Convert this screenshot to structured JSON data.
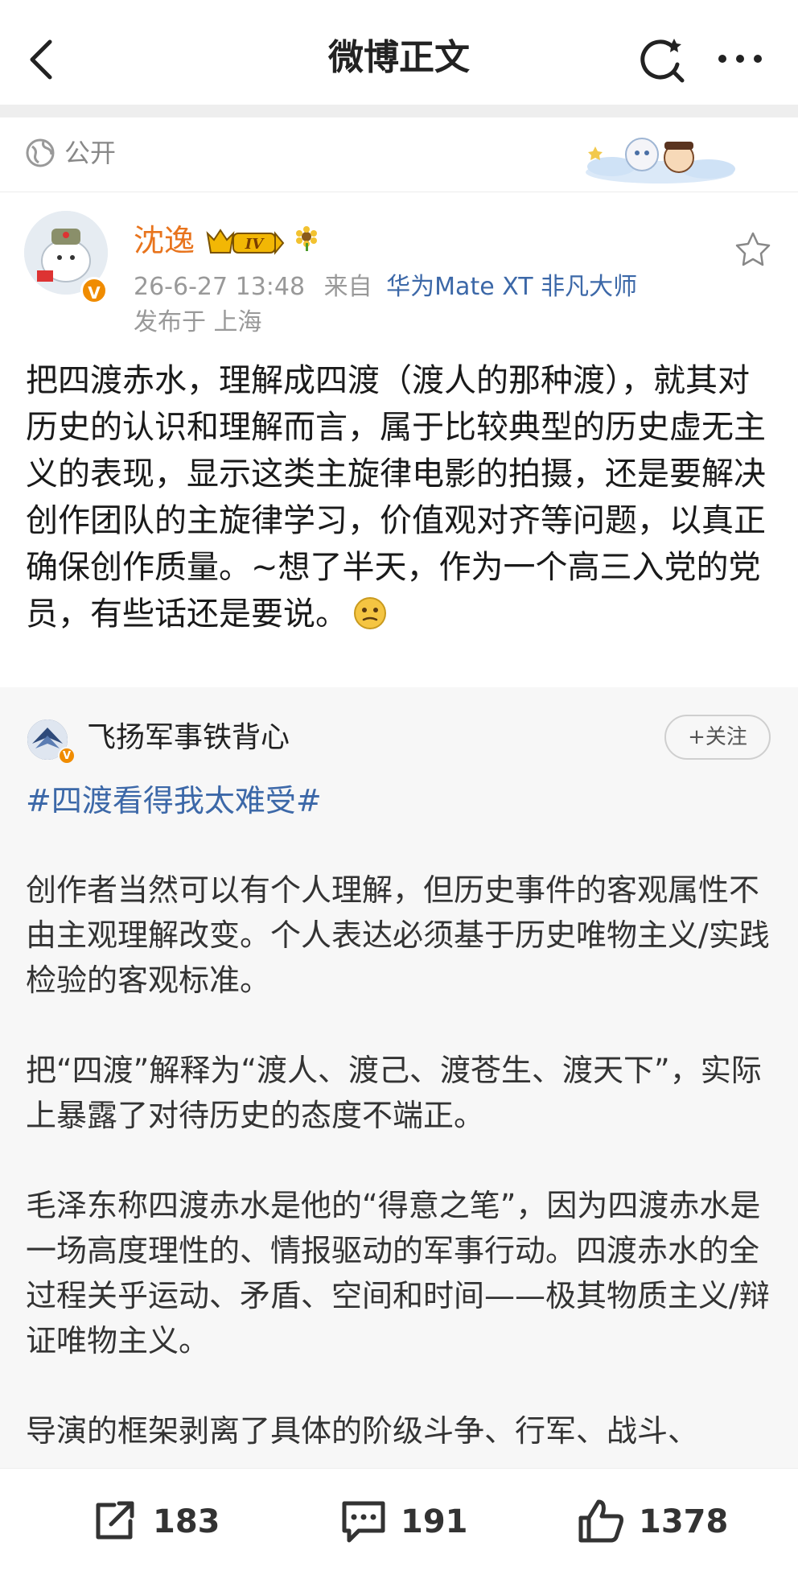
{
  "header": {
    "title": "微博正文"
  },
  "visibility": {
    "label": "公开"
  },
  "author": {
    "name": "沈逸",
    "level": "IV",
    "verified_badge": "V",
    "timestamp": "26-6-27 13:48",
    "source_prefix": "来自",
    "device": "华为Mate XT 非凡大师",
    "location": "发布于 上海"
  },
  "post": {
    "text": "把四渡赤水，理解成四渡（渡人的那种渡），就其对历史的认识和理解而言，属于比较典型的历史虚无主义的表现，显示这类主旋律电影的拍摄，还是要解决创作团队的主旋律学习，价值观对齐等问题，以真正确保创作质量。~想了半天，作为一个高三入党的党员，有些话还是要说。"
  },
  "repost": {
    "author": "飞扬军事铁背心",
    "follow_label": "+关注",
    "hashtag": "#四渡看得我太难受#",
    "paragraphs": [
      "创作者当然可以有个人理解，但历史事件的客观属性不由主观理解改变。个人表达必须基于历史唯物主义/实践检验的客观标准。",
      "把“四渡”解释为“渡人、渡己、渡苍生、渡天下”，实际上暴露了对待历史的态度不端正。",
      "毛泽东称四渡赤水是他的“得意之笔”，因为四渡赤水是一场高度理性的、情报驱动的军事行动。四渡赤水的全过程关乎运动、矛盾、空间和时间——极其物质主义/辩证唯物主义。",
      "导演的框架剥离了具体的阶级斗争、行军、战斗、"
    ]
  },
  "actions": {
    "repost_count": "183",
    "comment_count": "191",
    "like_count": "1378"
  },
  "colors": {
    "author_name": "#e8741d",
    "link_blue": "#3c68a8",
    "verified_orange": "#f08c00"
  }
}
